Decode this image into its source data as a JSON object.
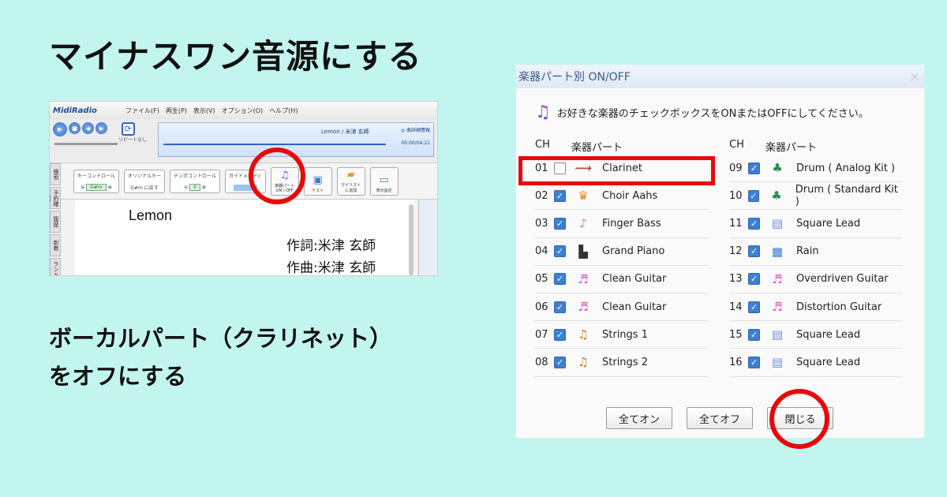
{
  "headline": "マイナスワン音源にする",
  "instruction": {
    "line1": "ボーカルパート（クラリネット）",
    "line2": "をオフにする"
  },
  "app": {
    "logo": "MidiRadio",
    "menu": [
      "ファイル(F)",
      "再生(P)",
      "表示(V)",
      "オプション(O)",
      "ヘルプ(H)"
    ],
    "repeat_label": "リピートなし",
    "song": "Lemon / 米津 玄師",
    "detail_label": "◎ 曲詳細情報",
    "time": "00:00/04:21",
    "key_control": {
      "label": "キーコントロール",
      "value": "G#m"
    },
    "original_key": {
      "label": "オリジナルキー",
      "value": "G#m に戻す"
    },
    "tempo_control": {
      "label": "テンポコントロール",
      "value": "0"
    },
    "guide_melody": {
      "label": "ガイドメロディ"
    },
    "instrument_button": {
      "label1": "楽器パート",
      "label2": "ON / OFF"
    },
    "test_button": "テスト",
    "mylist_button": {
      "label1": "マイリスト",
      "label2": "に追加"
    },
    "display_button": "表示設定",
    "side_tabs": [
      "検索",
      "予約確認",
      "履歴",
      "新着",
      "ランキ"
    ],
    "lyrics": {
      "title": "Lemon",
      "lyricist": "作詞:米津 玄師",
      "composer": "作曲:米津 玄師"
    }
  },
  "dialog": {
    "title": "楽器パート別 ON/OFF",
    "close_glyph": "×",
    "message": "お好きな楽器のチェックボックスをONまたはOFFにしてください。",
    "col_ch": "CH",
    "col_part": "楽器パート",
    "channels": [
      {
        "ch": "01",
        "name": "Clarinet",
        "on": false,
        "icon": "clarinet-icon",
        "glyph": "⟿",
        "color": "#b0352e"
      },
      {
        "ch": "02",
        "name": "Choir Aahs",
        "on": true,
        "icon": "choir-icon",
        "glyph": "♛",
        "color": "#e08a18"
      },
      {
        "ch": "03",
        "name": "Finger Bass",
        "on": true,
        "icon": "bass-icon",
        "glyph": "♪",
        "color": "#e070c8"
      },
      {
        "ch": "04",
        "name": "Grand Piano",
        "on": true,
        "icon": "piano-icon",
        "glyph": "▙",
        "color": "#333333"
      },
      {
        "ch": "05",
        "name": "Clean Guitar",
        "on": true,
        "icon": "guitar-icon",
        "glyph": "♬",
        "color": "#e050c0"
      },
      {
        "ch": "06",
        "name": "Clean Guitar",
        "on": true,
        "icon": "guitar-icon",
        "glyph": "♬",
        "color": "#e050c0"
      },
      {
        "ch": "07",
        "name": "Strings 1",
        "on": true,
        "icon": "strings-icon",
        "glyph": "♫",
        "color": "#c27a18"
      },
      {
        "ch": "08",
        "name": "Strings 2",
        "on": true,
        "icon": "strings-icon",
        "glyph": "♫",
        "color": "#c27a18"
      },
      {
        "ch": "09",
        "name": "Drum ( Analog Kit )",
        "on": true,
        "icon": "drum-icon",
        "glyph": "♣",
        "color": "#2e8a52"
      },
      {
        "ch": "10",
        "name": "Drum ( Standard Kit )",
        "on": true,
        "icon": "drum-icon",
        "glyph": "♣",
        "color": "#2e8a52"
      },
      {
        "ch": "11",
        "name": "Square Lead",
        "on": true,
        "icon": "synth-icon",
        "glyph": "▤",
        "color": "#6a8fd8"
      },
      {
        "ch": "12",
        "name": "Rain",
        "on": true,
        "icon": "rain-icon",
        "glyph": "▦",
        "color": "#3a78d0"
      },
      {
        "ch": "13",
        "name": "Overdriven Guitar",
        "on": true,
        "icon": "guitar-icon",
        "glyph": "♬",
        "color": "#e050c0"
      },
      {
        "ch": "14",
        "name": "Distortion Guitar",
        "on": true,
        "icon": "guitar-icon",
        "glyph": "♬",
        "color": "#e050c0"
      },
      {
        "ch": "15",
        "name": "Square Lead",
        "on": true,
        "icon": "synth-icon",
        "glyph": "▤",
        "color": "#6a8fd8"
      },
      {
        "ch": "16",
        "name": "Square Lead",
        "on": true,
        "icon": "synth-icon",
        "glyph": "▤",
        "color": "#6a8fd8"
      }
    ],
    "buttons": {
      "all_on": "全てオン",
      "all_off": "全てオフ",
      "close": "閉じる"
    }
  },
  "colors": {
    "background": "#c3f5ef",
    "highlight": "#e8080c",
    "checkbox": "#3c7fd6"
  }
}
